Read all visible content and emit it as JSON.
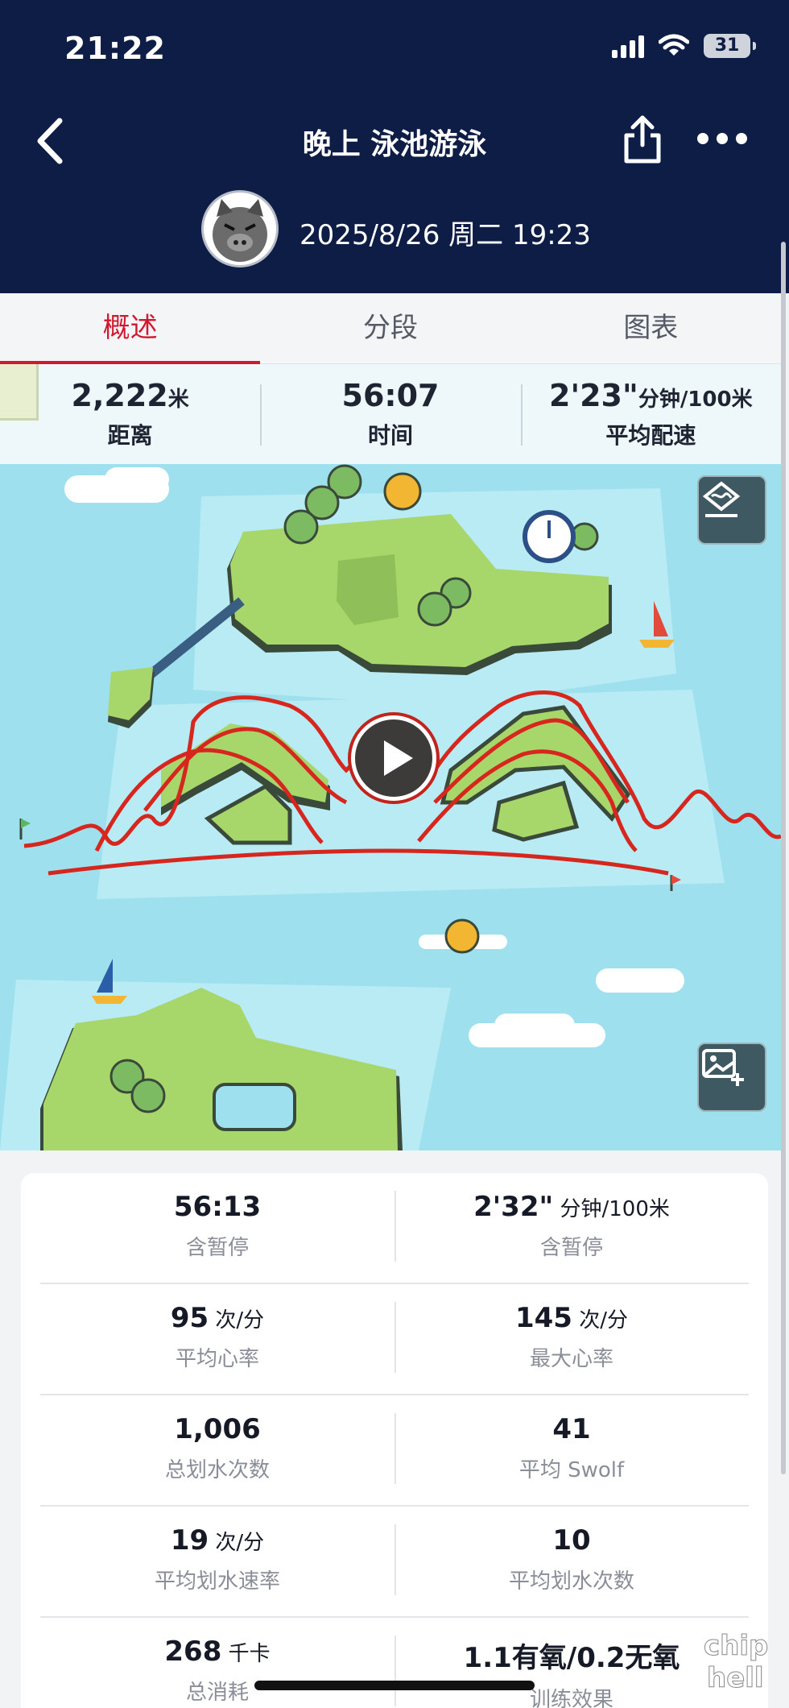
{
  "status_bar": {
    "time": "21:22",
    "battery": "31"
  },
  "nav": {
    "title": "晚上 泳池游泳",
    "date": "2025/8/26 周二 19:23"
  },
  "tabs": [
    {
      "label": "概述",
      "active": true
    },
    {
      "label": "分段",
      "active": false
    },
    {
      "label": "图表",
      "active": false
    }
  ],
  "summary": [
    {
      "value": "2,222",
      "unit": "米",
      "label": "距离"
    },
    {
      "value": "56:07",
      "unit": "",
      "label": "时间"
    },
    {
      "value": "2'23\"",
      "unit": "分钟/100米",
      "label": "平均配速"
    }
  ],
  "stats": [
    [
      {
        "value": "56:13",
        "unit": "",
        "label": "含暂停"
      },
      {
        "value": "2'32\"",
        "unit": " 分钟/100米",
        "label": "含暂停"
      }
    ],
    [
      {
        "value": "95",
        "unit": " 次/分",
        "label": "平均心率"
      },
      {
        "value": "145",
        "unit": " 次/分",
        "label": "最大心率"
      }
    ],
    [
      {
        "value": "1,006",
        "unit": "",
        "label": "总划水次数"
      },
      {
        "value": "41",
        "unit": "",
        "label": "平均 Swolf"
      }
    ],
    [
      {
        "value": "19",
        "unit": " 次/分",
        "label": "平均划水速率"
      },
      {
        "value": "10",
        "unit": "",
        "label": "平均划水次数"
      }
    ],
    [
      {
        "value": "268",
        "unit": " 千卡",
        "label": "总消耗"
      },
      {
        "value": "1.1有氧/0.2无氧",
        "unit": "",
        "label": "训练效果"
      }
    ]
  ],
  "colors": {
    "header": "#0e1d45",
    "accent": "#d0182f",
    "water": "#9ee0ee",
    "land": "#a7d66b",
    "track": "#d7261e"
  },
  "watermark": "chiphell"
}
